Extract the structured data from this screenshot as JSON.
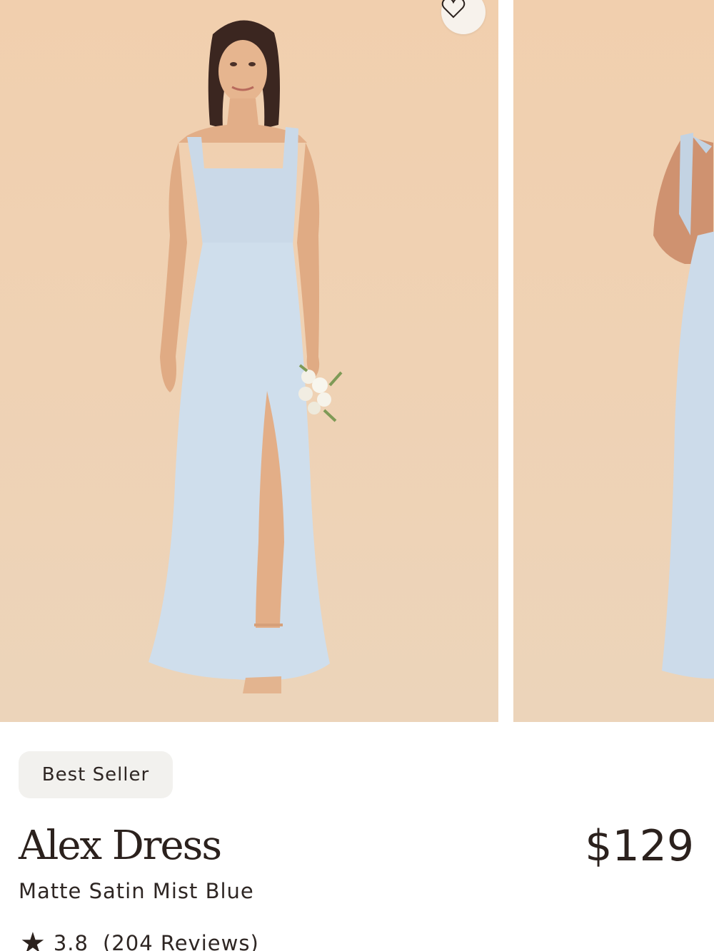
{
  "product": {
    "badge": "Best Seller",
    "name": "Alex Dress",
    "price": "$129",
    "variant": "Matte Satin Mist Blue",
    "rating": "3.8",
    "reviews": "(204 Reviews)"
  },
  "carousel": {
    "images": [
      {
        "subject": "model in mist blue satin gown with bouquet"
      },
      {
        "subject": "model in mist blue gown, partial view"
      }
    ],
    "icons": {
      "wishlist": "heart-outline-icon",
      "rating": "star-icon"
    }
  },
  "colors": {
    "backdrop": "#efd2b4",
    "dress": "#cddcea",
    "text": "#2b211d",
    "badge_bg": "#f2f1ee"
  }
}
